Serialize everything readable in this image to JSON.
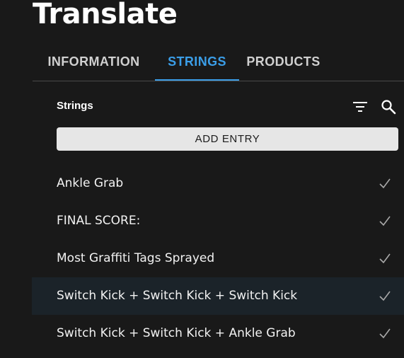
{
  "header": {
    "title": "Translate"
  },
  "tabs": [
    {
      "label": "INFORMATION",
      "active": false
    },
    {
      "label": "STRINGS",
      "active": true
    },
    {
      "label": "PRODUCTS",
      "active": false
    }
  ],
  "strings_panel": {
    "heading": "Strings",
    "add_entry_label": "ADD ENTRY",
    "icons": {
      "filter": "filter-icon",
      "search": "search-icon",
      "done": "checkmark-icon"
    },
    "items": [
      {
        "label": "Ankle Grab",
        "selected": false
      },
      {
        "label": "FINAL SCORE:",
        "selected": false
      },
      {
        "label": "Most Graffiti Tags Sprayed",
        "selected": false
      },
      {
        "label": "Switch Kick + Switch Kick + Switch Kick",
        "selected": true
      },
      {
        "label": "Switch Kick + Switch Kick + Ankle Grab",
        "selected": false
      }
    ]
  },
  "colors": {
    "background": "#191919",
    "accent": "#3b9ee8",
    "selected_row": "#1b2329",
    "button_bg": "#e6e6e6"
  }
}
